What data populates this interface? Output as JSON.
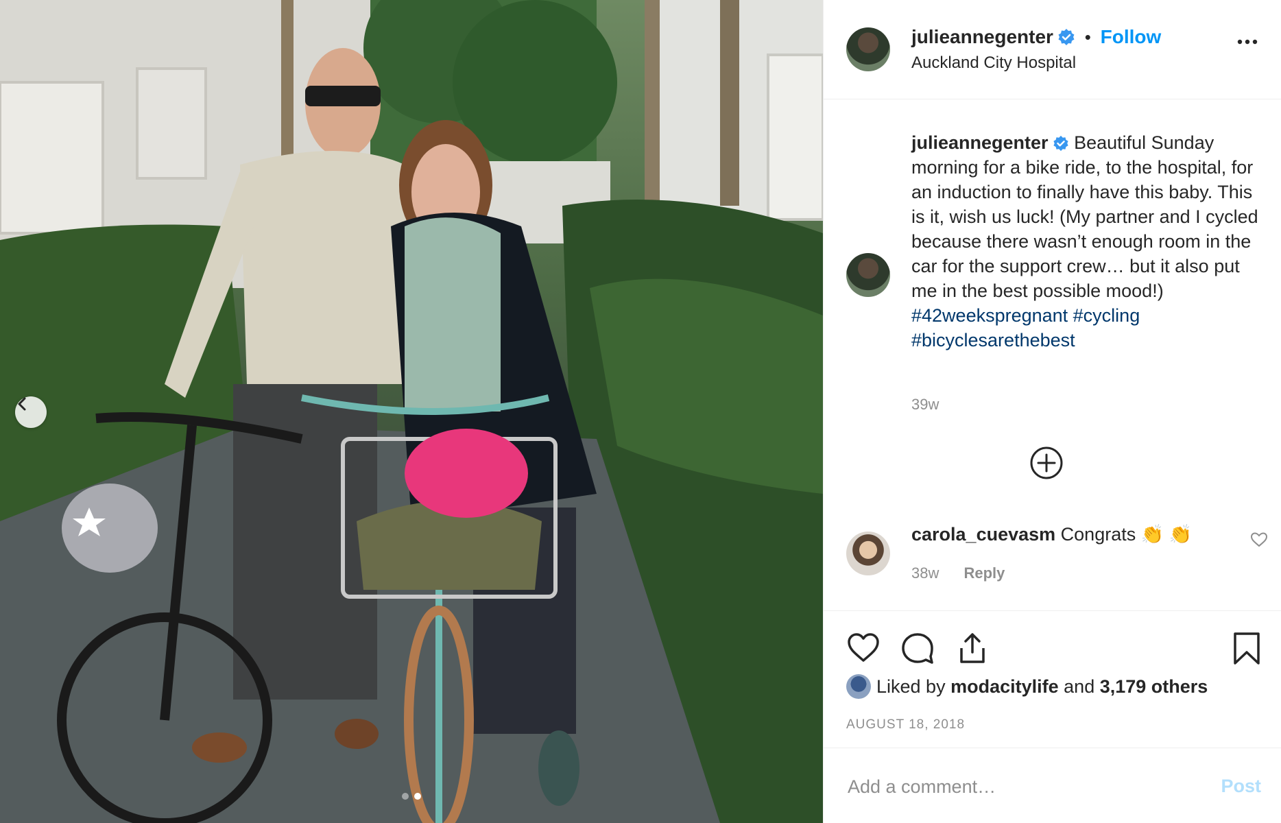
{
  "photo": {
    "prev_icon": "chevron-left-icon",
    "carousel_pages": 2,
    "active_page": 2
  },
  "header": {
    "username": "julieannegenter",
    "verified_icon": "verified-badge-icon",
    "separator": "•",
    "follow_label": "Follow",
    "location": "Auckland City Hospital",
    "more_icon": "more-options-icon"
  },
  "caption": {
    "username": "julieannegenter",
    "text": "Beautiful Sunday morning for a bike ride, to the hospital, for an induction to finally have this baby. This is it, wish us luck! (My partner and I cycled because there wasn’t enough room in the car for the support crew… but it also put me in the best possible mood!)",
    "hashtags": "#42weekspregnant #cycling #bicyclesarethebest",
    "time": "39w",
    "load_more_icon": "plus-circle-icon"
  },
  "comment": {
    "username": "carola_cuevasm",
    "text": "Congrats 👏 👏",
    "time": "38w",
    "reply_label": "Reply",
    "like_icon": "heart-outline-icon"
  },
  "actions": {
    "like_icon": "heart-icon",
    "comment_icon": "comment-bubble-icon",
    "share_icon": "share-icon",
    "save_icon": "bookmark-icon",
    "liked_by_prefix": "Liked by",
    "liked_by_user": "modacitylife",
    "liked_by_and": "and",
    "liked_by_others": "3,179 others",
    "date": "AUGUST 18, 2018"
  },
  "add_comment": {
    "placeholder": "Add a comment…",
    "post_label": "Post"
  },
  "colors": {
    "link_blue": "#0095f6",
    "hashtag_blue": "#00376b",
    "muted_text": "#8e8e8e",
    "post_disabled": "#b2dffc"
  }
}
